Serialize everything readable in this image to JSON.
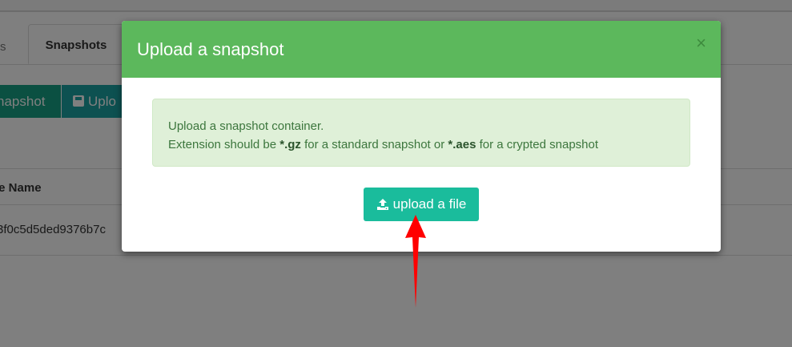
{
  "background": {
    "tab_partial_label": "s",
    "tab_snapshots_label": "Snapshots",
    "button_snapshot_label": "napshot",
    "button_upload_label": "Uplo",
    "table_header": "le Name",
    "table_cell": "3f0c5d5ded9376b7c"
  },
  "modal": {
    "title": "Upload a snapshot",
    "close_label": "×",
    "info_line1": "Upload a snapshot container.",
    "info_line2_prefix": "Extension should be ",
    "ext_gz": "*.gz",
    "info_line2_mid": " for a standard snapshot or ",
    "ext_aes": "*.aes",
    "info_line2_suffix": " for a crypted snapshot",
    "upload_button_label": "upload a file",
    "upload_icon": "upload-icon"
  },
  "colors": {
    "modal_header": "#5cb85c",
    "alert_bg": "#dff0d8",
    "upload_button": "#1abc9c",
    "annotation_arrow": "#ff0000"
  }
}
